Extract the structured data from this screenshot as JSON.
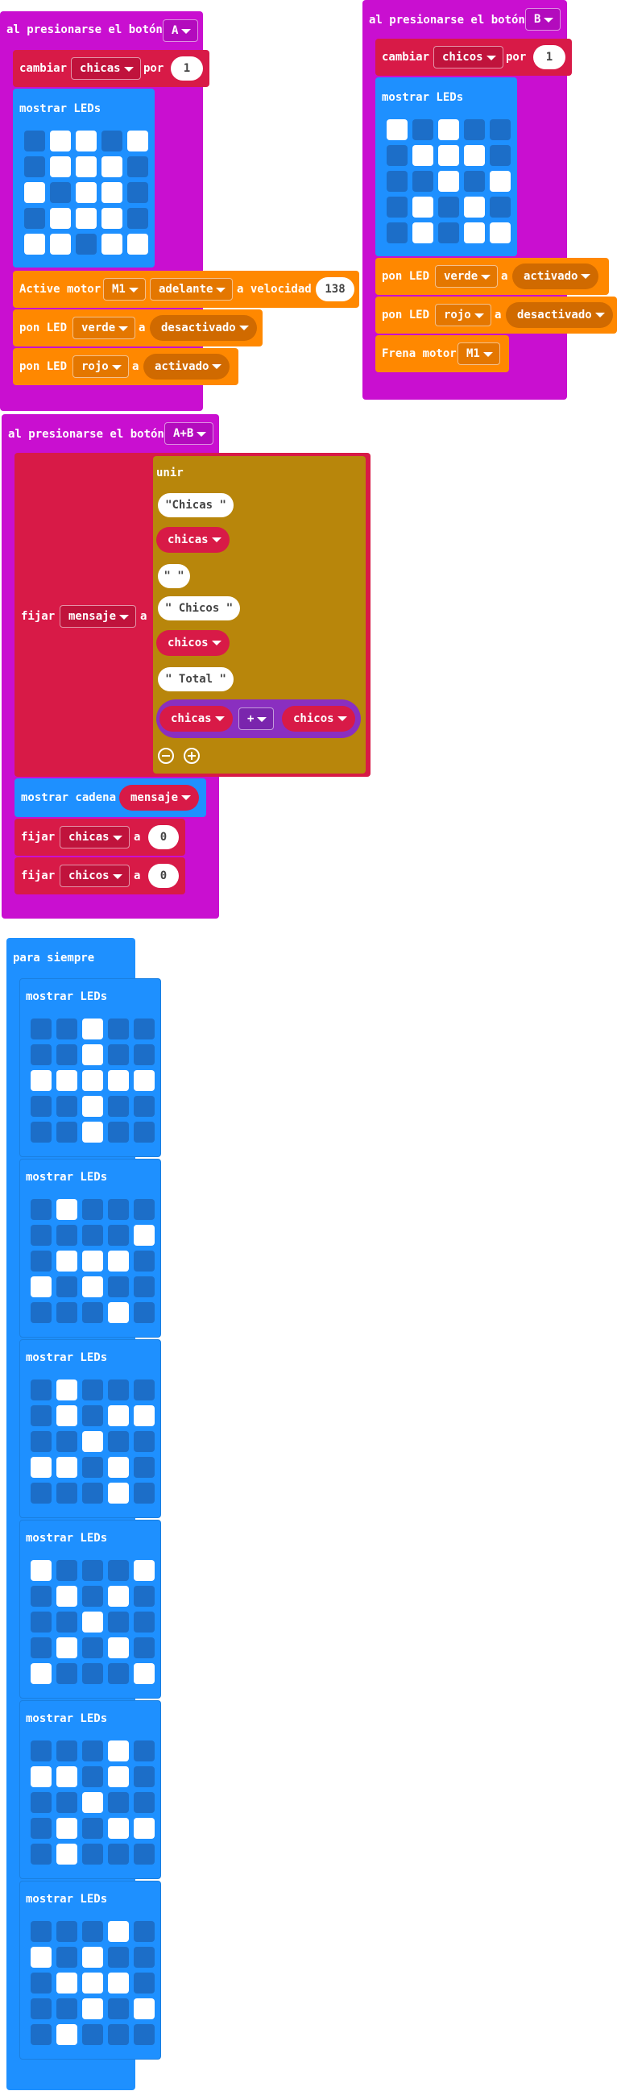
{
  "colors": {
    "event": "#c90fd0",
    "variables": "#d81a47",
    "basic": "#1e90ff",
    "motor": "#ff8800",
    "text": "#b8860b",
    "math": "#8a2fc0"
  },
  "event_a": {
    "header": "al presionarse el botón",
    "button": "A"
  },
  "event_b": {
    "header": "al presionarse el botón",
    "button": "B"
  },
  "event_ab": {
    "header": "al presionarse el botón",
    "button": "A+B"
  },
  "forever": {
    "header": "para siempre"
  },
  "labels": {
    "change": "cambiar",
    "by": "por",
    "show_leds": "mostrar LEDs",
    "motor": "Active motor",
    "forward": "adelante",
    "at_speed": "a velocidad",
    "set_led": "pon LED",
    "to": "a",
    "brake": "Frena motor",
    "set": "fijar",
    "join": "unir",
    "show_string": "mostrar cadena",
    "plus": "+"
  },
  "vars": {
    "girls": "chicas",
    "boys": "chicos",
    "message": "mensaje"
  },
  "values": {
    "one": "1",
    "zero": "0",
    "speed": "138",
    "motor_id": "M1",
    "green": "verde",
    "red": "rojo",
    "on": "activado",
    "off": "desactivado"
  },
  "strings": {
    "s1": "\"Chicas \"",
    "s2": "\" \"",
    "s3": "\" Chicos \"",
    "s4": "\" Total \""
  },
  "leds": {
    "a": [
      [
        0,
        1,
        1,
        0,
        1
      ],
      [
        0,
        1,
        1,
        1,
        0
      ],
      [
        1,
        0,
        1,
        1,
        0
      ],
      [
        0,
        1,
        1,
        1,
        0
      ],
      [
        1,
        1,
        0,
        1,
        1
      ]
    ],
    "b": [
      [
        1,
        0,
        1,
        0,
        0
      ],
      [
        0,
        1,
        1,
        1,
        0
      ],
      [
        0,
        0,
        1,
        0,
        1
      ],
      [
        0,
        1,
        0,
        1,
        0
      ],
      [
        0,
        1,
        0,
        1,
        1
      ]
    ],
    "f1": [
      [
        0,
        0,
        1,
        0,
        0
      ],
      [
        0,
        0,
        1,
        0,
        0
      ],
      [
        1,
        1,
        1,
        1,
        1
      ],
      [
        0,
        0,
        1,
        0,
        0
      ],
      [
        0,
        0,
        1,
        0,
        0
      ]
    ],
    "f2": [
      [
        0,
        1,
        0,
        0,
        0
      ],
      [
        0,
        0,
        0,
        0,
        1
      ],
      [
        0,
        1,
        1,
        1,
        0
      ],
      [
        1,
        0,
        1,
        0,
        0
      ],
      [
        0,
        0,
        0,
        1,
        0
      ]
    ],
    "f3": [
      [
        0,
        1,
        0,
        0,
        0
      ],
      [
        0,
        1,
        0,
        1,
        1
      ],
      [
        0,
        0,
        1,
        0,
        0
      ],
      [
        1,
        1,
        0,
        1,
        0
      ],
      [
        0,
        0,
        0,
        1,
        0
      ]
    ],
    "f4": [
      [
        1,
        0,
        0,
        0,
        1
      ],
      [
        0,
        1,
        0,
        1,
        0
      ],
      [
        0,
        0,
        1,
        0,
        0
      ],
      [
        0,
        1,
        0,
        1,
        0
      ],
      [
        1,
        0,
        0,
        0,
        1
      ]
    ],
    "f5": [
      [
        0,
        0,
        0,
        1,
        0
      ],
      [
        1,
        1,
        0,
        1,
        0
      ],
      [
        0,
        0,
        1,
        0,
        0
      ],
      [
        0,
        1,
        0,
        1,
        1
      ],
      [
        0,
        1,
        0,
        0,
        0
      ]
    ],
    "f6": [
      [
        0,
        0,
        0,
        1,
        0
      ],
      [
        1,
        0,
        1,
        0,
        0
      ],
      [
        0,
        1,
        1,
        1,
        0
      ],
      [
        0,
        0,
        1,
        0,
        1
      ],
      [
        0,
        1,
        0,
        0,
        0
      ]
    ]
  }
}
